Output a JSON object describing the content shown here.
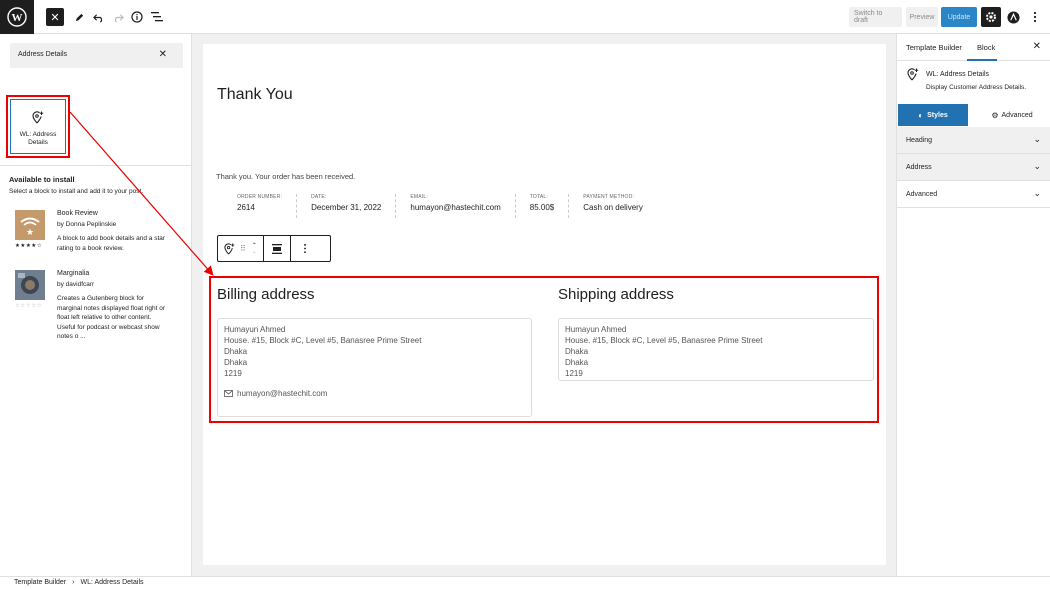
{
  "topbar": {
    "switch_to_draft": "Switch to draft",
    "preview": "Preview",
    "update": "Update"
  },
  "inserter": {
    "search_value": "Address Details",
    "block_label": "WL: Address Details",
    "available_title": "Available to install",
    "available_sub": "Select a block to install and add it to your post.",
    "plugins": [
      {
        "name": "Book Review",
        "author": "by Donna Peplinskie",
        "description": "A block to add book details and a star rating to a book review."
      },
      {
        "name": "Marginalia",
        "author": "by davidfcarr",
        "description": "Creates a Gutenberg block for marginal notes displayed float right or float left relative to other content. Useful for podcast or webcast show notes o ..."
      }
    ]
  },
  "canvas": {
    "title": "Thank You",
    "thanks_text": "Thank you. Your order has been received.",
    "order": [
      {
        "label": "Order number:",
        "value": "2614"
      },
      {
        "label": "Date:",
        "value": "December 31, 2022"
      },
      {
        "label": "Email:",
        "value": "humayon@hastechit.com"
      },
      {
        "label": "Total:",
        "value": "85.00$"
      },
      {
        "label": "Payment method:",
        "value": "Cash on delivery"
      }
    ],
    "billing": {
      "title": "Billing address",
      "lines": [
        "Humayun Ahmed",
        "House. #15, Block #C, Level #5, Banasree Prime Street",
        "Dhaka",
        "Dhaka",
        "1219"
      ],
      "email": "humayon@hastechit.com"
    },
    "shipping": {
      "title": "Shipping address",
      "lines": [
        "Humayun Ahmed",
        "House. #15, Block #C, Level #5, Banasree Prime Street",
        "Dhaka",
        "Dhaka",
        "1219"
      ]
    }
  },
  "sidebar": {
    "tab_template": "Template Builder",
    "tab_block": "Block",
    "block_title": "WL: Address Details",
    "block_desc": "Display Customer Address Details.",
    "styles_tab": "Styles",
    "advanced_tab": "Advanced",
    "sections": [
      "Heading",
      "Address",
      "Advanced"
    ]
  },
  "breadcrumb": {
    "root": "Template Builder",
    "current": "WL: Address Details"
  },
  "colors": {
    "accent": "#2271b1",
    "highlight": "#e00000",
    "dark": "#1e1e1e"
  }
}
